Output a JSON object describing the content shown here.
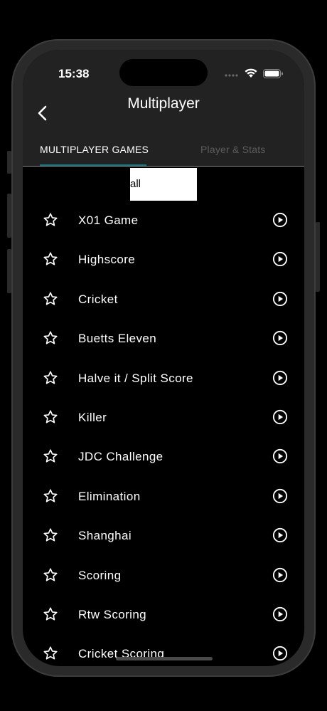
{
  "status_bar": {
    "time": "15:38"
  },
  "nav": {
    "title": "Multiplayer",
    "back_icon": "chevron-left-icon"
  },
  "tabs": [
    {
      "label": "MULTIPLAYER GAMES",
      "active": true
    },
    {
      "label": "Player & Stats",
      "active": false
    }
  ],
  "filter": {
    "text": "all"
  },
  "games": [
    {
      "label": "X01 Game"
    },
    {
      "label": "Highscore"
    },
    {
      "label": "Cricket"
    },
    {
      "label": "Buetts Eleven"
    },
    {
      "label": "Halve it / Split Score"
    },
    {
      "label": "Killer"
    },
    {
      "label": "JDC Challenge"
    },
    {
      "label": "Elimination"
    },
    {
      "label": "Shanghai"
    },
    {
      "label": "Scoring"
    },
    {
      "label": "Rtw Scoring"
    },
    {
      "label": "Cricket Scoring"
    }
  ],
  "colors": {
    "accent": "#0e7c86",
    "header_bg": "#222222",
    "background": "#000000"
  }
}
